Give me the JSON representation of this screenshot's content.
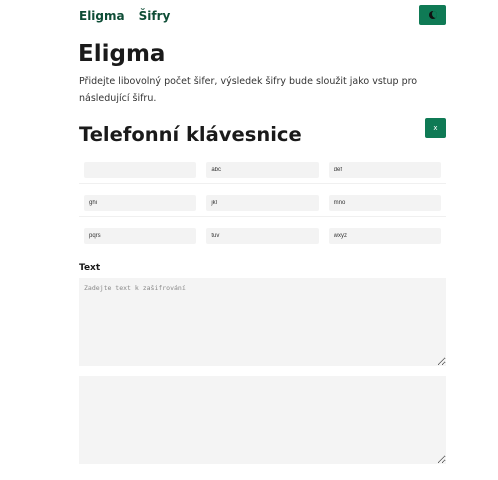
{
  "nav": {
    "items": [
      "Eligma",
      "Šifry"
    ]
  },
  "theme_toggle": {
    "icon": "moon-icon"
  },
  "page": {
    "title": "Eligma",
    "intro": "Přidejte libovolný počet šifer, výsledek šifry bude sloužit jako vstup pro následující šifru."
  },
  "cipher": {
    "title": "Telefonní klávesnice",
    "remove_label": "x",
    "keys": [
      [
        "",
        "abc",
        "def"
      ],
      [
        "ghi",
        "jkl",
        "mno"
      ],
      [
        "pqrs",
        "tuv",
        "wxyz"
      ]
    ]
  },
  "input": {
    "label": "Text",
    "placeholder": "Zadejte text k zašifrování"
  },
  "output": {
    "value": ""
  },
  "colors": {
    "accent": "#0f7a55",
    "nav_text": "#0e4d36"
  }
}
